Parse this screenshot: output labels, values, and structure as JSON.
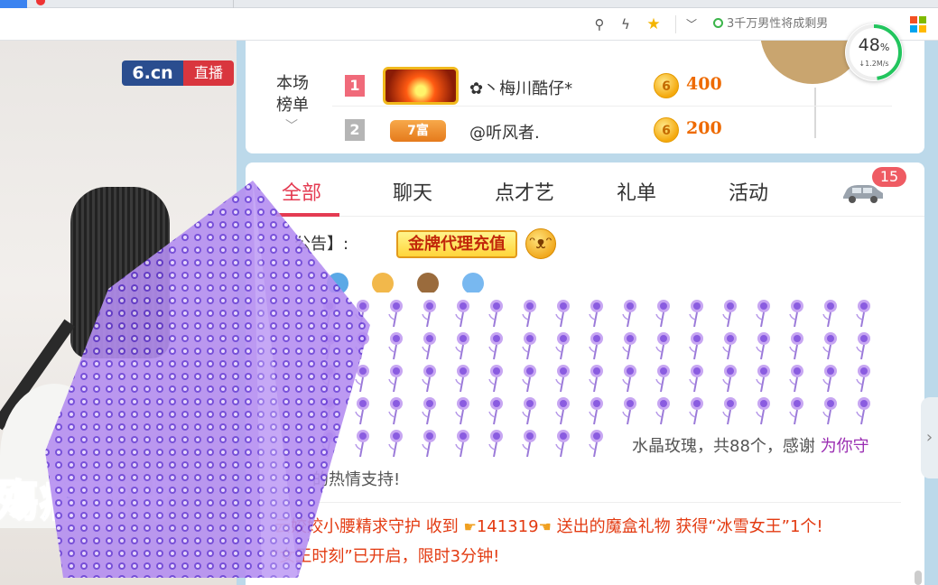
{
  "browser": {
    "search_hint": "3千万男性将成剩男",
    "net_speed_percent": 48,
    "percent_sign": "%",
    "net_speed_rate": "↓1.2M/s"
  },
  "video": {
    "logo_left": "6.cn",
    "logo_right": "直播",
    "caption": "殤痛我背"
  },
  "ranking": {
    "title_line1": "本场",
    "title_line2": "榜单",
    "rows": [
      {
        "rank": "1",
        "name": "✿丶梅川酷仔*",
        "coin": "6",
        "score": "400"
      },
      {
        "rank": "2",
        "badge": "7富",
        "name": "@听风者.",
        "coin": "6",
        "score": "200"
      }
    ]
  },
  "tabs": {
    "items": [
      {
        "label": "全部"
      },
      {
        "label": "聊天"
      },
      {
        "label": "点才艺"
      },
      {
        "label": "礼单"
      },
      {
        "label": "活动"
      }
    ],
    "car_badge": "15"
  },
  "chat": {
    "notice_label": "公告】:",
    "notice_button": "金牌代理充值",
    "gift_text": "水晶玫瑰，共88个，感谢",
    "gift_sender": "为你守",
    "gift_text_cont": "的热情支持!",
    "sys_msg_prefix": "云姣姣小腰精求守护 收到",
    "sys_msg_number": "141319",
    "sys_msg_suffix": "送出的魔盒礼物 获得“冰雪女王”1个!",
    "sys_msg2": "“女王时刻”已开启，限时3分钟!"
  },
  "colors": {
    "accent": "#e43b52",
    "system_msg": "#e33b12",
    "score": "#ee6a00"
  }
}
